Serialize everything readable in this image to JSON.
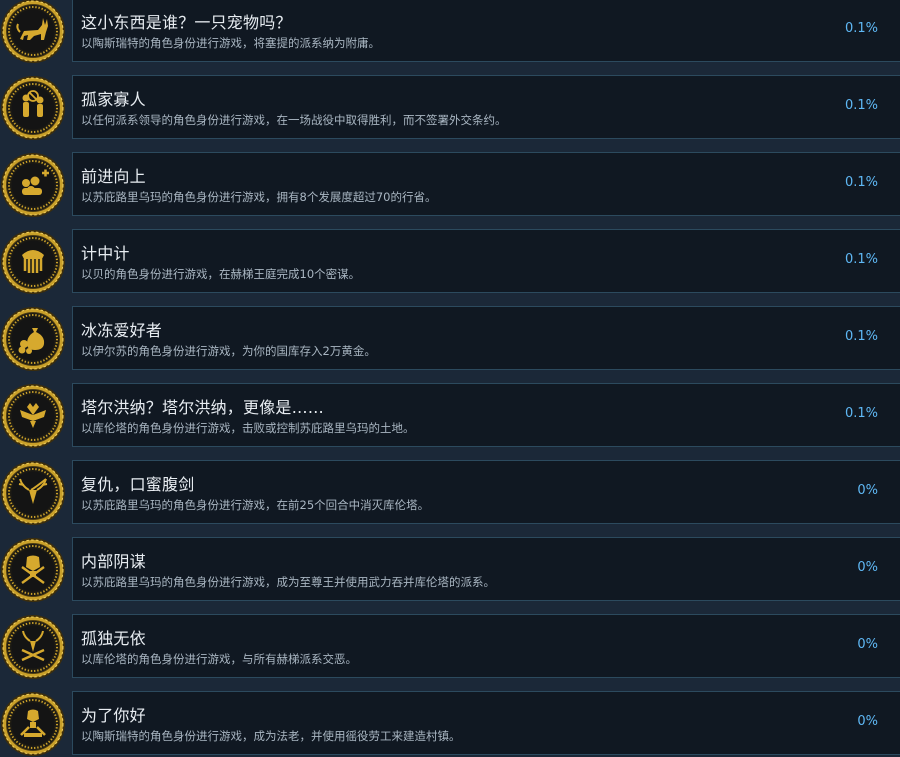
{
  "colors": {
    "background": "#1b2838",
    "card": "#101822",
    "card_border": "#2c4a5e",
    "title": "#e8edf2",
    "description": "#a9b6c2",
    "percent": "#5fb8f5",
    "badge_gold": "#d6a92e",
    "badge_dark": "#141414"
  },
  "achievements": [
    {
      "title": "这小东西是谁？一只宠物吗？",
      "description": "以陶斯瑞特的角色身份进行游戏，将塞提的派系纳为附庸。",
      "percent": "0.1%",
      "icon": "jackal-badge-icon"
    },
    {
      "title": "孤家寡人",
      "description": "以任何派系领导的角色身份进行游戏，在一场战役中取得胜利，而不签署外交条约。",
      "percent": "0.1%",
      "icon": "refusing-figures-badge-icon"
    },
    {
      "title": "前进向上",
      "description": "以苏庇路里乌玛的角色身份进行游戏，拥有8个发展度超过70的行省。",
      "percent": "0.1%",
      "icon": "crowd-plus-badge-icon"
    },
    {
      "title": "计中计",
      "description": "以贝的角色身份进行游戏，在赫梯王庭完成10个密谋。",
      "percent": "0.1%",
      "icon": "puppet-hand-badge-icon"
    },
    {
      "title": "冰冻爱好者",
      "description": "以伊尔苏的角色身份进行游戏，为你的国库存入2万黄金。",
      "percent": "0.1%",
      "icon": "gold-sack-badge-icon"
    },
    {
      "title": "塔尔洪纳？塔尔洪纳，更像是……",
      "description": "以库伦塔的角色身份进行游戏，击败或控制苏庇路里乌玛的土地。",
      "percent": "0.1%",
      "icon": "double-eagle-badge-icon"
    },
    {
      "title": "复仇，口蜜腹剑",
      "description": "以苏庇路里乌玛的角色身份进行游戏，在前25个回合中消灭库伦塔。",
      "percent": "0%",
      "icon": "stag-head-badge-icon"
    },
    {
      "title": "内部阴谋",
      "description": "以苏庇路里乌玛的角色身份进行游戏，成为至尊王并使用武力吞并库伦塔的派系。",
      "percent": "0%",
      "icon": "pharaoh-crossed-badge-icon"
    },
    {
      "title": "孤独无依",
      "description": "以库伦塔的角色身份进行游戏，与所有赫梯派系交恶。",
      "percent": "0%",
      "icon": "stag-crossed-badge-icon"
    },
    {
      "title": "为了你好",
      "description": "以陶斯瑞特的角色身份进行游戏，成为法老，并使用徭役劳工来建造村镇。",
      "percent": "0%",
      "icon": "pharaoh-tools-badge-icon"
    }
  ]
}
